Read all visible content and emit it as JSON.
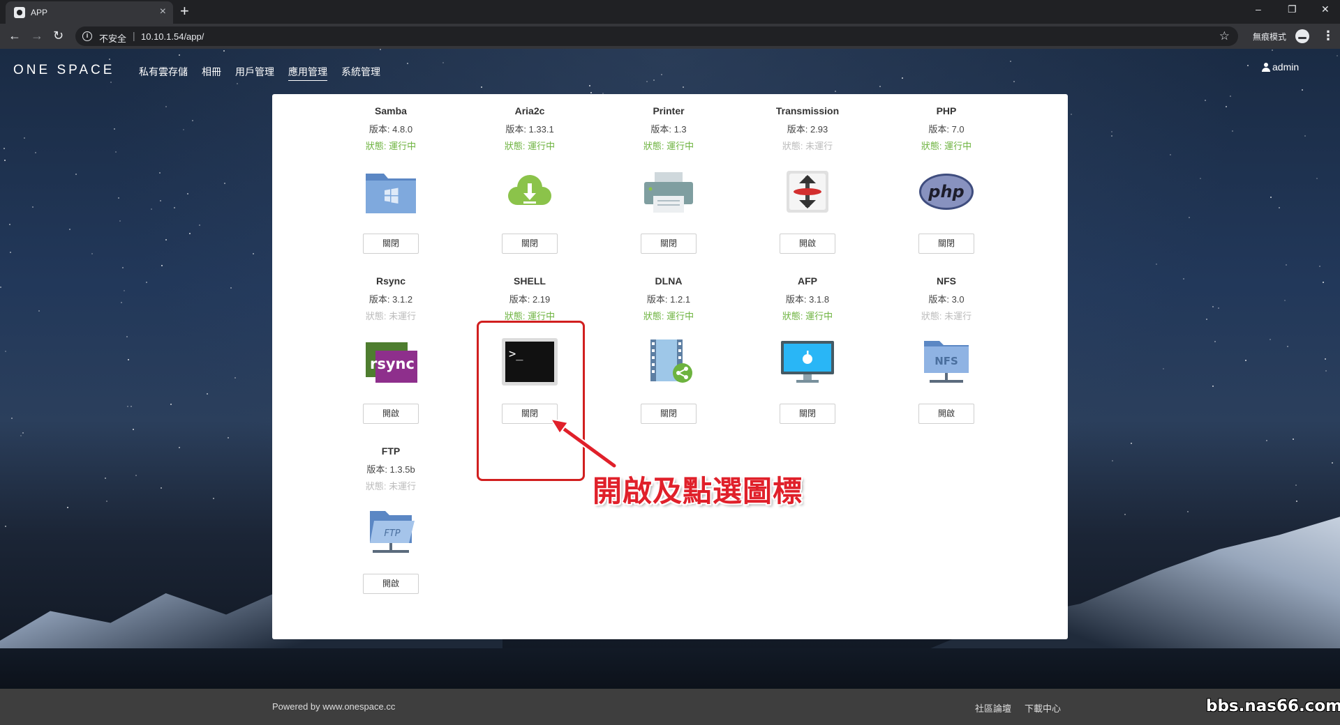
{
  "browser": {
    "tab_title": "APP",
    "new_tab": "+",
    "close_tab": "×",
    "security_label": "不安全",
    "url": "10.10.1.54/app/",
    "incognito_label": "無痕模式",
    "window_controls": [
      "–",
      "❐",
      "✕"
    ]
  },
  "header": {
    "brand": "ONE SPACE",
    "nav": [
      "私有雲存儲",
      "相冊",
      "用戶管理",
      "應用管理",
      "系統管理"
    ],
    "active_nav": "應用管理",
    "user": "admin"
  },
  "apps": [
    {
      "name": "Samba",
      "version": "版本: 4.8.0",
      "status": "狀態: 運行中",
      "running": true,
      "button": "關閉",
      "icon": "samba-folder-icon"
    },
    {
      "name": "Aria2c",
      "version": "版本: 1.33.1",
      "status": "狀態: 運行中",
      "running": true,
      "button": "關閉",
      "icon": "download-cloud-icon"
    },
    {
      "name": "Printer",
      "version": "版本: 1.3",
      "status": "狀態: 運行中",
      "running": true,
      "button": "關閉",
      "icon": "printer-icon"
    },
    {
      "name": "Transmission",
      "version": "版本: 2.93",
      "status": "狀態: 未運行",
      "running": false,
      "button": "開啟",
      "icon": "transmission-icon"
    },
    {
      "name": "PHP",
      "version": "版本: 7.0",
      "status": "狀態: 運行中",
      "running": true,
      "button": "關閉",
      "icon": "php-icon"
    },
    {
      "name": "Rsync",
      "version": "版本: 3.1.2",
      "status": "狀態: 未運行",
      "running": false,
      "button": "開啟",
      "icon": "rsync-icon"
    },
    {
      "name": "SHELL",
      "version": "版本: 2.19",
      "status": "狀態: 運行中",
      "running": true,
      "button": "關閉",
      "icon": "terminal-icon"
    },
    {
      "name": "DLNA",
      "version": "版本: 1.2.1",
      "status": "狀態: 運行中",
      "running": true,
      "button": "關閉",
      "icon": "dlna-icon"
    },
    {
      "name": "AFP",
      "version": "版本: 3.1.8",
      "status": "狀態: 運行中",
      "running": true,
      "button": "關閉",
      "icon": "afp-monitor-icon"
    },
    {
      "name": "NFS",
      "version": "版本: 3.0",
      "status": "狀態: 未運行",
      "running": false,
      "button": "開啟",
      "icon": "nfs-folder-icon"
    },
    {
      "name": "FTP",
      "version": "版本: 1.3.5b",
      "status": "狀態: 未運行",
      "running": false,
      "button": "開啟",
      "icon": "ftp-folder-icon"
    }
  ],
  "icon_text": {
    "php": "php",
    "rsync": "rsync",
    "nfs": "NFS",
    "ftp": "FTP",
    "terminal": ">_"
  },
  "annotation": {
    "text": "開啟及點選圖標"
  },
  "footer": {
    "powered": "Powered by www.onespace.cc",
    "links": [
      "社區論壇",
      "下載中心"
    ],
    "watermark": "bbs.nas66.com"
  },
  "colors": {
    "running": "#6db33f",
    "stopped": "#bbbbbb",
    "annotation": "#e0202a"
  }
}
